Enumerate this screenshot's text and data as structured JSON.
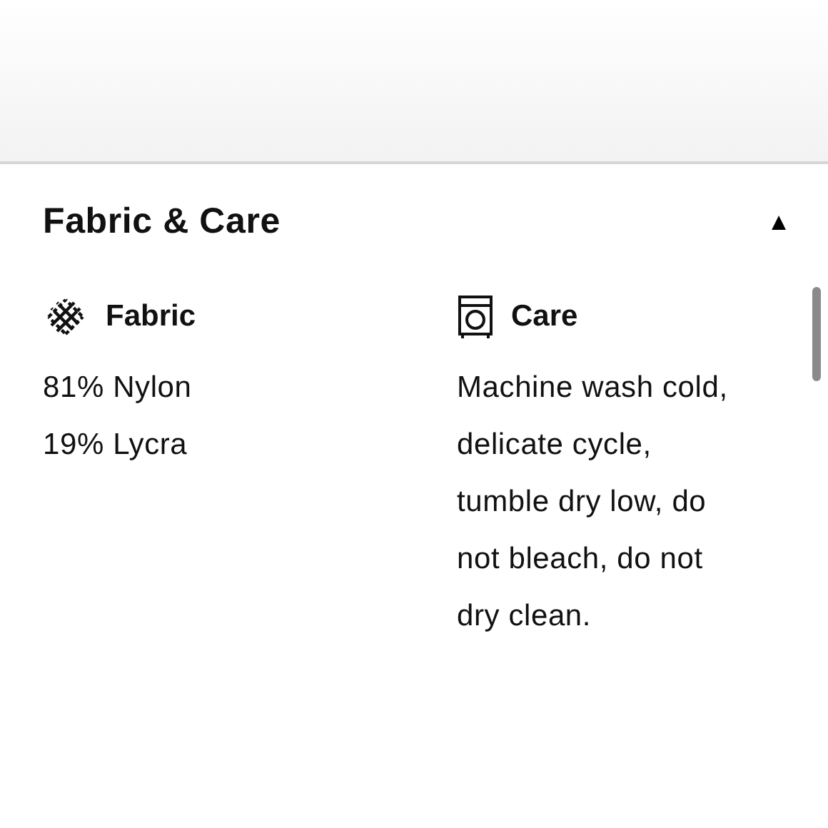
{
  "section": {
    "title": "Fabric & Care",
    "toggle": "▲"
  },
  "columns": [
    {
      "kind": "fabric",
      "heading": "Fabric",
      "lines": [
        "81% Nylon",
        "19% Lycra"
      ]
    },
    {
      "kind": "care",
      "heading": "Care",
      "paragraph": [
        "Machine wash cold,",
        "delicate cycle,",
        "tumble dry low, do",
        "not bleach, do not",
        "dry clean."
      ]
    }
  ]
}
